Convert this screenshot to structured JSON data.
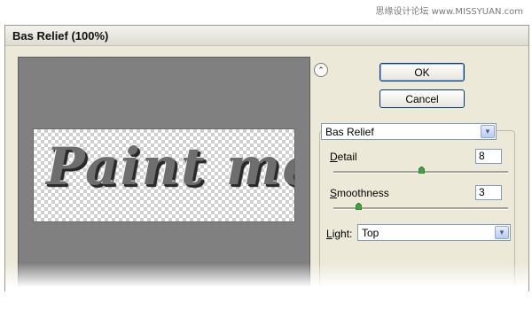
{
  "watermark": "思缘设计论坛 www.MISSYUAN.com",
  "dialog": {
    "title": "Bas Relief (100%)"
  },
  "preview": {
    "text": "Paint me"
  },
  "buttons": {
    "ok": "OK",
    "cancel": "Cancel"
  },
  "filter_select": {
    "value": "Bas Relief"
  },
  "params": {
    "detail": {
      "label_prefix": "",
      "label_key": "D",
      "label_rest": "etail",
      "value": "8",
      "min": 1,
      "max": 15
    },
    "smoothness": {
      "label_prefix": "",
      "label_key": "S",
      "label_rest": "moothness",
      "value": "3",
      "min": 1,
      "max": 15
    }
  },
  "light": {
    "label_key": "L",
    "label_rest": "ight:",
    "value": "Top"
  },
  "icons": {
    "collapse": "double-chevron-up-icon",
    "dropdown": "chevron-down-icon"
  },
  "colors": {
    "slider_thumb": "#3ea23e",
    "button_border": "#003c74"
  }
}
